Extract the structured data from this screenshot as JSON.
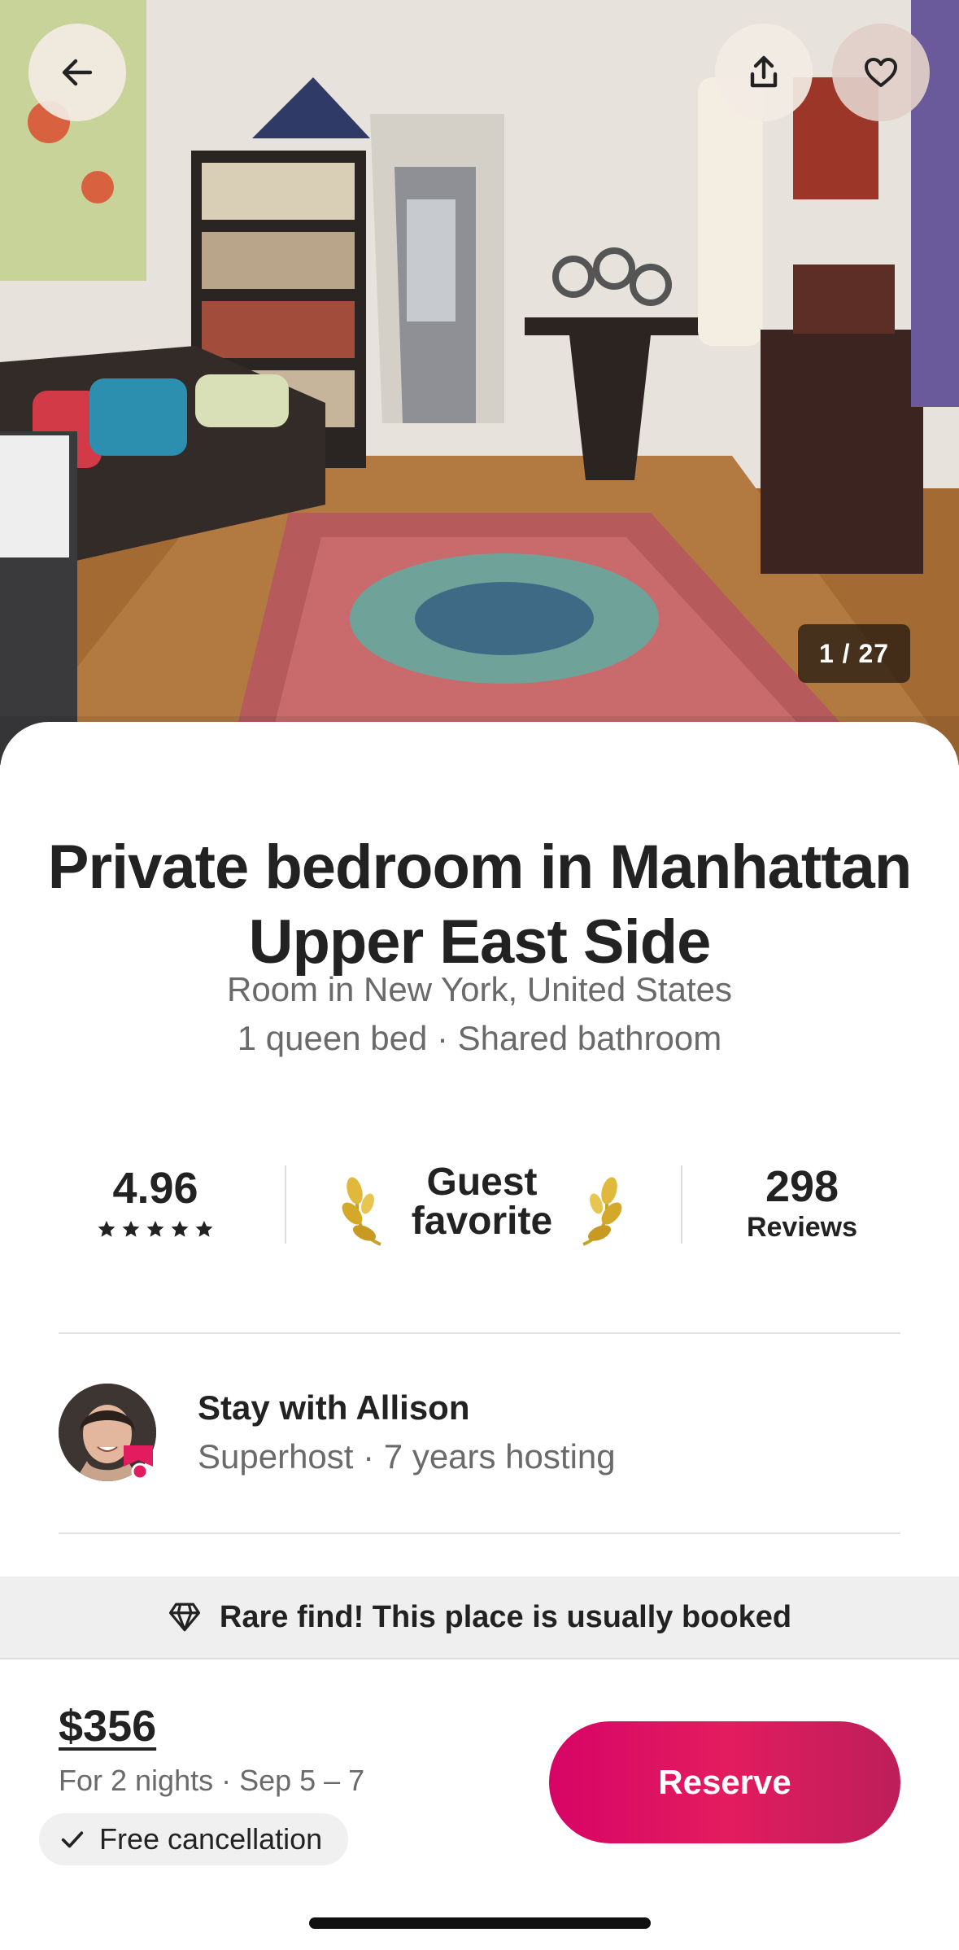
{
  "header": {
    "back_icon": "arrow-left-icon",
    "share_icon": "share-icon",
    "favorite_icon": "heart-icon",
    "photo_counter": "1 / 27"
  },
  "listing": {
    "title": "Private bedroom in Manhattan Upper East Side",
    "subtitle_line1": "Room in New York, United States",
    "subtitle_line2": "1 queen bed · Shared bathroom"
  },
  "stats": {
    "rating": "4.96",
    "stars": 5,
    "guest_favorite_line1": "Guest",
    "guest_favorite_line2": "favorite",
    "reviews_count": "298",
    "reviews_label": "Reviews"
  },
  "host": {
    "name_line": "Stay with Allison",
    "meta_line": "Superhost · 7 years hosting"
  },
  "banner": {
    "icon": "diamond-icon",
    "text": "Rare find! This place is usually booked"
  },
  "booking": {
    "price": "$356",
    "price_meta": "For 2 nights · Sep 5 – 7",
    "free_cancellation": "Free cancellation",
    "reserve_label": "Reserve"
  },
  "colors": {
    "accent": "#e31c5f",
    "text_primary": "#222222",
    "text_secondary": "#6a6a6a"
  }
}
